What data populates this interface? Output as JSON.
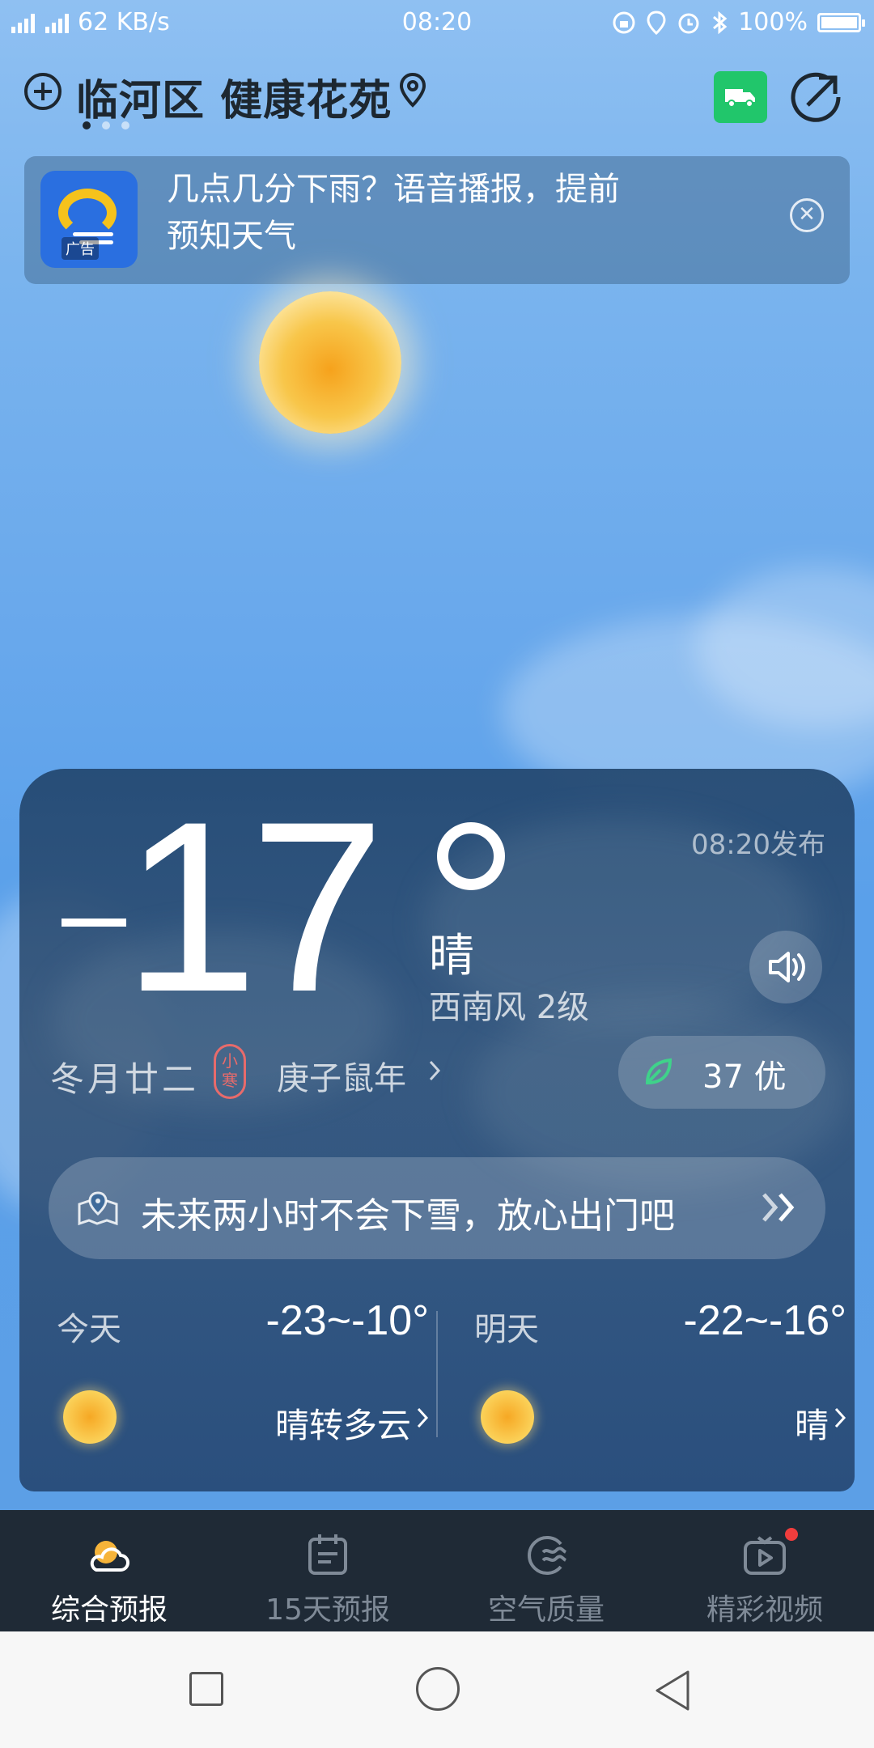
{
  "status_bar": {
    "network": "4G",
    "network2": "2G",
    "speed": "62 KB/s",
    "time": "08:20",
    "battery": "100%"
  },
  "header": {
    "location": "临河区 健康花苑",
    "page_dots": 3,
    "active_page": 0
  },
  "ad": {
    "text": "几点几分下雨？语音播报，提前预知天气",
    "tag": "广告"
  },
  "current": {
    "temperature": "17",
    "sign": "-",
    "publish_time": "08:20发布",
    "condition": "晴",
    "wind": "西南风 2级",
    "lunar_date": "冬月廿二",
    "solar_term": "小寒",
    "zodiac_year": "庚子鼠年",
    "aqi": "37 优"
  },
  "alert": {
    "text": "未来两小时不会下雪，放心出门吧"
  },
  "forecast": [
    {
      "day": "今天",
      "range": "-23~-10°",
      "condition": "晴转多云"
    },
    {
      "day": "明天",
      "range": "-22~-16°",
      "condition": "晴"
    }
  ],
  "tabs": [
    {
      "label": "综合预报",
      "active": true
    },
    {
      "label": "15天预报",
      "active": false
    },
    {
      "label": "空气质量",
      "active": false
    },
    {
      "label": "精彩视频",
      "active": false
    }
  ],
  "colors": {
    "accent_green": "#21c66b",
    "tabbar_bg": "#1f2a36",
    "badge_red": "#f03d3d"
  }
}
